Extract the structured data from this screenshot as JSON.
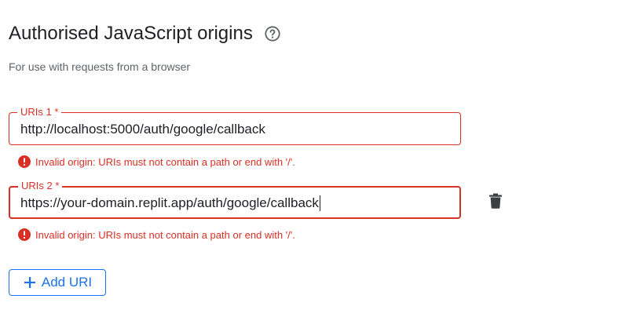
{
  "section": {
    "title": "Authorised JavaScript origins",
    "help_icon": "help-circle-icon",
    "subtitle": "For use with requests from a browser"
  },
  "uris": [
    {
      "label": "URIs 1 *",
      "value": "http://localhost:5000/auth/google/callback",
      "error": "Invalid origin: URIs must not contain a path or end with '/'."
    },
    {
      "label": "URIs 2 *",
      "value": "https://your-domain.replit.app/auth/google/callback",
      "error": "Invalid origin: URIs must not contain a path or end with '/'.",
      "delete_icon": "trash-icon"
    }
  ],
  "add_button": {
    "label": "Add URI",
    "icon": "plus-icon"
  },
  "colors": {
    "error": "#d93025",
    "accent": "#1a73e8",
    "text": "#202124",
    "secondary_text": "#5f6368"
  }
}
